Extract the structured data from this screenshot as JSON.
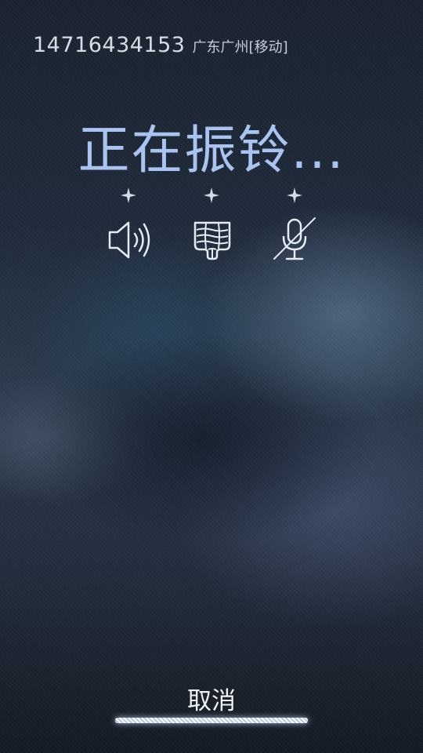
{
  "caller": {
    "number": "14716434153",
    "location": "广东广州[移动]"
  },
  "call_status": "正在振铃...",
  "controls": [
    {
      "icon": "speaker-icon",
      "label": ""
    },
    {
      "icon": "dialpad-icon",
      "label": ""
    },
    {
      "icon": "mic-off-icon",
      "label": ""
    }
  ],
  "cancel": {
    "label": "取消"
  },
  "colors": {
    "status_text": "#a9c4f0",
    "background": "#1f2b3b",
    "icon": "#e6ebf2"
  }
}
